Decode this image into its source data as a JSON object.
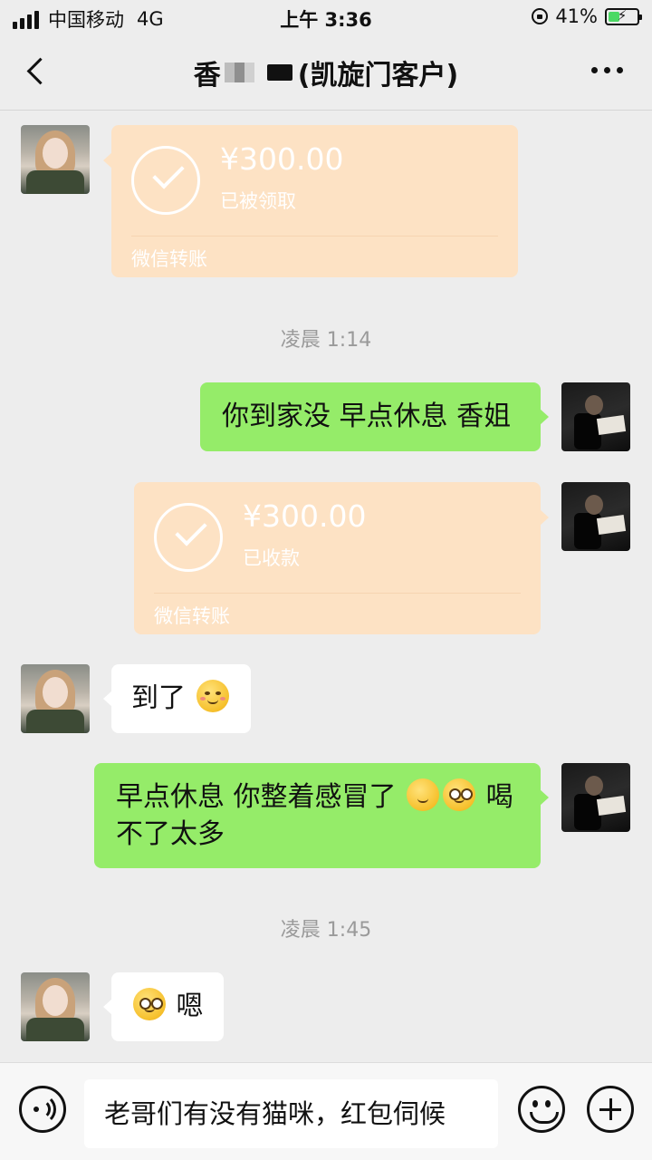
{
  "status_bar": {
    "carrier": "中国移动",
    "network": "4G",
    "time": "上午 3:36",
    "battery_percent": "41%",
    "battery_level": 0.41,
    "charging": true
  },
  "header": {
    "title_prefix": "香",
    "title_suffix": "(凯旋门客户)"
  },
  "messages": [
    {
      "type": "transfer",
      "direction": "in",
      "amount": "¥300.00",
      "status": "已被领取",
      "label": "微信转账"
    },
    {
      "type": "timestamp",
      "text": "凌晨 1:14"
    },
    {
      "type": "text",
      "direction": "out",
      "text": "你到家没 早点休息 香姐"
    },
    {
      "type": "transfer",
      "direction": "out",
      "amount": "¥300.00",
      "status": "已收款",
      "label": "微信转账"
    },
    {
      "type": "text",
      "direction": "in",
      "text": "到了",
      "emoji": "smiling-face-emoji"
    },
    {
      "type": "text",
      "direction": "out",
      "text_line1": "早点休息 你整着感冒了",
      "text_line1_end": "喝",
      "text_line2": "不了太多",
      "emojis": [
        "sneezing-face-emoji",
        "dizzy-face-emoji"
      ]
    },
    {
      "type": "timestamp",
      "text": "凌晨 1:45"
    },
    {
      "type": "text",
      "direction": "in",
      "text": "嗯",
      "emoji": "flushed-face-emoji"
    }
  ],
  "input_bar": {
    "value": "老哥们有没有猫咪，红包伺候"
  },
  "colors": {
    "background": "#ededed",
    "outgoing_bubble": "#95ec69",
    "incoming_bubble": "#ffffff",
    "transfer_card": "#fde2c4",
    "timestamp_text": "#9a9a9a"
  }
}
